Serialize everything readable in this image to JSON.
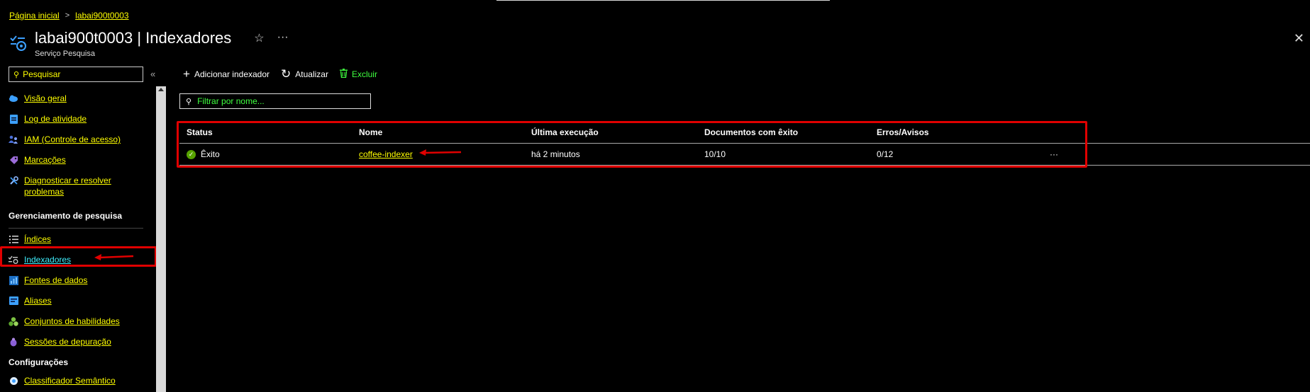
{
  "breadcrumb": {
    "home": "Página inicial",
    "resource": "labai900t0003",
    "separator": ">"
  },
  "header": {
    "title": "labai900t0003 | Indexadores",
    "subtitle": "Serviço Pesquisa",
    "star": "☆",
    "more": "···",
    "close": "✕"
  },
  "sidebar": {
    "search_placeholder": "Pesquisar",
    "search_glyph": "⚲",
    "collapse": "«",
    "items_top": [
      {
        "label": "Visão geral",
        "icon": "cloud-icon"
      },
      {
        "label": "Log de atividade",
        "icon": "log-icon"
      },
      {
        "label": "IAM (Controle de acesso)",
        "icon": "people-icon"
      },
      {
        "label": "Marcações",
        "icon": "tag-icon"
      },
      {
        "label": "Diagnosticar e resolver problemas",
        "icon": "wrench-icon"
      }
    ],
    "section_search_mgmt": "Gerenciamento de pesquisa",
    "items_mgmt": [
      {
        "label": "Índices",
        "icon": "list-icon"
      },
      {
        "label": "Indexadores",
        "icon": "indexer-icon"
      },
      {
        "label": "Fontes de dados",
        "icon": "datasource-icon"
      },
      {
        "label": "Aliases",
        "icon": "alias-icon"
      },
      {
        "label": "Conjuntos de habilidades",
        "icon": "skillset-icon"
      },
      {
        "label": "Sessões de depuração",
        "icon": "debug-icon"
      }
    ],
    "section_config": "Configurações",
    "items_config": [
      {
        "label": "Classificador Semântico",
        "icon": "semantic-icon"
      }
    ]
  },
  "toolbar": {
    "add_glyph": "+",
    "add_label": "Adicionar indexador",
    "refresh_glyph": "↻",
    "refresh_label": "Atualizar",
    "delete_label": "Excluir"
  },
  "filter": {
    "placeholder": "Filtrar por nome...",
    "glyph": "⚲"
  },
  "table": {
    "headers": [
      "Status",
      "Nome",
      "Última execução",
      "Documentos com êxito",
      "Erros/Avisos"
    ],
    "rows": [
      {
        "status": "Êxito",
        "name": "coffee-indexer",
        "last_run": "há 2 minutos",
        "docs": "10/10",
        "errors": "0/12",
        "more": "···"
      }
    ]
  },
  "colors": {
    "link": "#ffff00",
    "active_link": "#3ff0ff",
    "delete": "#3fff3f",
    "highlight": "#e00000",
    "success": "#57a300"
  }
}
